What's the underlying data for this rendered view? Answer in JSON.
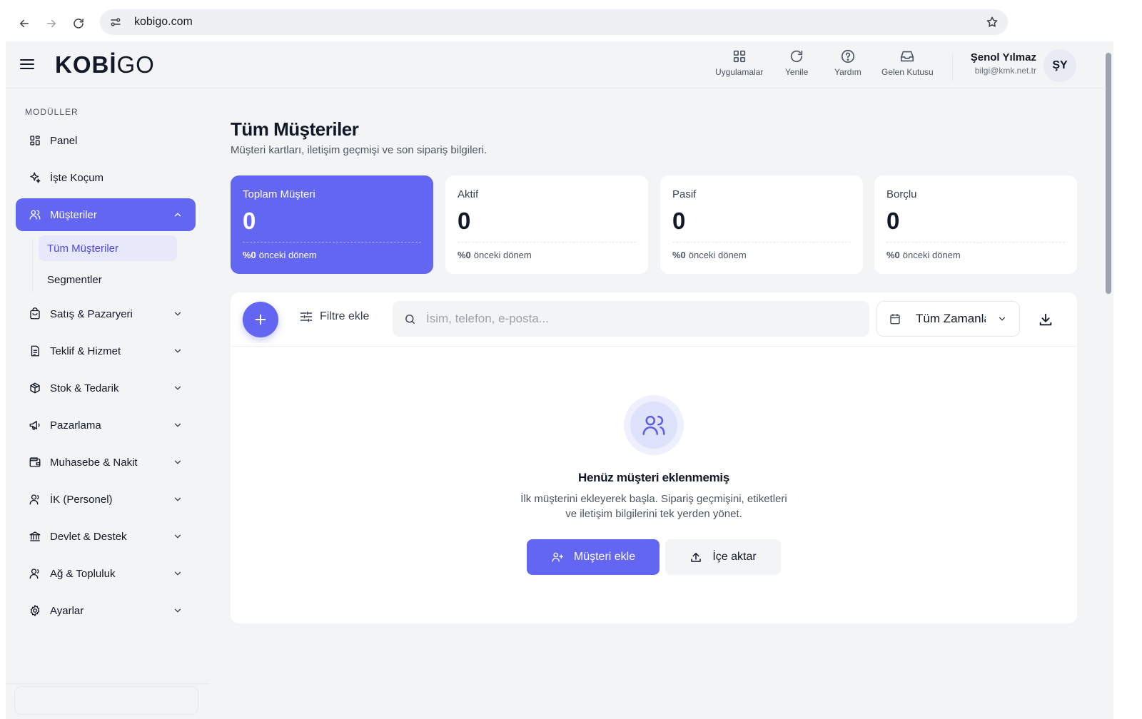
{
  "browser": {
    "url": "kobigo.com"
  },
  "app": {
    "logo_bold": "KOBİ",
    "logo_light": "GO",
    "toolbar": [
      {
        "label": "Uygulamalar",
        "icon": "grid-icon"
      },
      {
        "label": "Yenile",
        "icon": "refresh-icon"
      },
      {
        "label": "Yardım",
        "icon": "help-icon"
      },
      {
        "label": "Gelen Kutusu",
        "icon": "inbox-icon"
      }
    ],
    "user": {
      "name": "Şenol Yılmaz",
      "email": "bilgi@kmk.net.tr",
      "initials": "ŞY"
    }
  },
  "sidebar": {
    "section_label": "MODÜLLER",
    "items": [
      {
        "label": "Panel",
        "icon": "dashboard-icon"
      },
      {
        "label": "İşte Koçum",
        "icon": "sparkle-icon"
      },
      {
        "label": "Müşteriler",
        "icon": "users-icon",
        "active": true,
        "expanded": true
      },
      {
        "label": "Satış & Pazaryeri",
        "icon": "shopping-bag-icon"
      },
      {
        "label": "Teklif & Hizmet",
        "icon": "document-icon"
      },
      {
        "label": "Stok & Tedarik",
        "icon": "box-icon"
      },
      {
        "label": "Pazarlama",
        "icon": "megaphone-icon"
      },
      {
        "label": "Muhasebe & Nakit",
        "icon": "wallet-icon"
      },
      {
        "label": "İK (Personel)",
        "icon": "person-icon"
      },
      {
        "label": "Devlet & Destek",
        "icon": "bank-icon"
      },
      {
        "label": "Ağ & Topluluk",
        "icon": "network-icon"
      },
      {
        "label": "Ayarlar",
        "icon": "gear-icon"
      }
    ],
    "sub_items": [
      {
        "label": "Tüm Müşteriler",
        "active": true
      },
      {
        "label": "Segmentler"
      }
    ]
  },
  "page": {
    "title": "Tüm Müşteriler",
    "subtitle": "Müşteri kartları, iletişim geçmişi ve son sipariş bilgileri."
  },
  "stats": [
    {
      "label": "Toplam Müşteri",
      "value": "0",
      "change": "%0",
      "period": "önceki dönem"
    },
    {
      "label": "Aktif",
      "value": "0",
      "change": "%0",
      "period": "önceki dönem"
    },
    {
      "label": "Pasif",
      "value": "0",
      "change": "%0",
      "period": "önceki dönem"
    },
    {
      "label": "Borçlu",
      "value": "0",
      "change": "%0",
      "period": "önceki dönem"
    }
  ],
  "list": {
    "filter_label": "Filtre ekle",
    "search_placeholder": "İsim, telefon, e-posta...",
    "date_filter": "Tüm Zamanlar",
    "empty_title": "Henüz müşteri eklenmemiş",
    "empty_desc_line1": "İlk müşterini ekleyerek başla. Sipariş geçmişini, etiketleri",
    "empty_desc_line2": "ve iletişim bilgilerini tek yerden yönet.",
    "add_button": "Müşteri ekle",
    "import_button": "İçe aktar"
  },
  "colors": {
    "accent": "#6366f1",
    "background": "#f3f4f6",
    "card": "#ffffff"
  }
}
